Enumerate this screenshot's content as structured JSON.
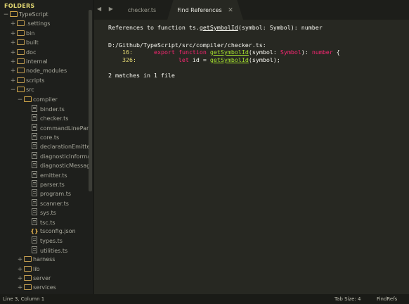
{
  "sidebar": {
    "header": "FOLDERS",
    "items": [
      {
        "label": "TypeScript",
        "type": "folder",
        "open": true,
        "depth": 0
      },
      {
        "label": ".settings",
        "type": "folder",
        "open": false,
        "depth": 1
      },
      {
        "label": "bin",
        "type": "folder",
        "open": false,
        "depth": 1
      },
      {
        "label": "built",
        "type": "folder",
        "open": false,
        "depth": 1
      },
      {
        "label": "doc",
        "type": "folder",
        "open": false,
        "depth": 1
      },
      {
        "label": "internal",
        "type": "folder",
        "open": false,
        "depth": 1
      },
      {
        "label": "node_modules",
        "type": "folder",
        "open": false,
        "depth": 1
      },
      {
        "label": "scripts",
        "type": "folder",
        "open": false,
        "depth": 1
      },
      {
        "label": "src",
        "type": "folder",
        "open": true,
        "depth": 1
      },
      {
        "label": "compiler",
        "type": "folder",
        "open": true,
        "depth": 2
      },
      {
        "label": "binder.ts",
        "type": "file",
        "depth": 3
      },
      {
        "label": "checker.ts",
        "type": "file",
        "depth": 3
      },
      {
        "label": "commandLinePar",
        "type": "file",
        "depth": 3
      },
      {
        "label": "core.ts",
        "type": "file",
        "depth": 3
      },
      {
        "label": "declarationEmitte",
        "type": "file",
        "depth": 3
      },
      {
        "label": "diagnosticInforma",
        "type": "file",
        "depth": 3
      },
      {
        "label": "diagnosticMessag",
        "type": "file",
        "depth": 3
      },
      {
        "label": "emitter.ts",
        "type": "file",
        "depth": 3
      },
      {
        "label": "parser.ts",
        "type": "file",
        "depth": 3
      },
      {
        "label": "program.ts",
        "type": "file",
        "depth": 3
      },
      {
        "label": "scanner.ts",
        "type": "file",
        "depth": 3
      },
      {
        "label": "sys.ts",
        "type": "file",
        "depth": 3
      },
      {
        "label": "tsc.ts",
        "type": "file",
        "depth": 3
      },
      {
        "label": "tsconfig.json",
        "type": "json",
        "depth": 3
      },
      {
        "label": "types.ts",
        "type": "file",
        "depth": 3
      },
      {
        "label": "utilities.ts",
        "type": "file",
        "depth": 3
      },
      {
        "label": "harness",
        "type": "folder",
        "open": false,
        "depth": 2
      },
      {
        "label": "lib",
        "type": "folder",
        "open": false,
        "depth": 2
      },
      {
        "label": "server",
        "type": "folder",
        "open": false,
        "depth": 2
      },
      {
        "label": "services",
        "type": "folder",
        "open": false,
        "depth": 2
      }
    ]
  },
  "tabs": {
    "nav": "◀ ▶",
    "checker": "checker.ts",
    "find": "Find References",
    "close": "✕"
  },
  "editor": {
    "heading_prefix": "References to function ts.",
    "heading_fn": "getSymbolId",
    "heading_suffix": "(symbol: Symbol): number",
    "file_path": "D:/Github/TypeScript/src/compiler/checker.ts:",
    "match1": {
      "line": "16:",
      "kw1": "export",
      "kw2": "function",
      "fn": "getSymbolId",
      "p1": "(symbol: ",
      "type": "Symbol",
      "p2": "): ",
      "ret": "number",
      "p3": " {"
    },
    "match2": {
      "line": "326:",
      "kw": "let",
      "p1": " id = ",
      "fn": "getSymbolId",
      "p2": "(symbol);"
    },
    "summary": "2 matches in 1 file"
  },
  "status": {
    "position": "Line 3, Column 1",
    "tab_size": "Tab Size: 4",
    "syntax": "FindRefs"
  },
  "colors": {
    "background": "#272822",
    "sidebar": "#1e1f1c",
    "keyword": "#f92672",
    "function": "#a6e22e",
    "number": "#e6db74"
  }
}
